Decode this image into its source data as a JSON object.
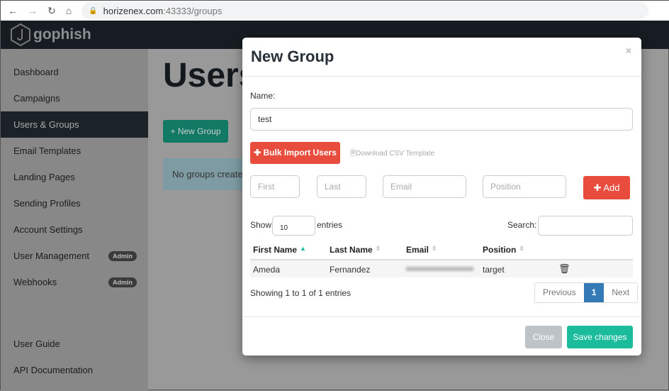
{
  "browser": {
    "url_host": "horizenex.com",
    "url_port": ":43333/groups"
  },
  "app": {
    "brand": "gophish"
  },
  "sidebar": {
    "items": [
      {
        "label": "Dashboard"
      },
      {
        "label": "Campaigns"
      },
      {
        "label": "Users & Groups",
        "active": true
      },
      {
        "label": "Email Templates"
      },
      {
        "label": "Landing Pages"
      },
      {
        "label": "Sending Profiles"
      },
      {
        "label": "Account Settings"
      },
      {
        "label": "User Management",
        "badge": "Admin"
      },
      {
        "label": "Webhooks",
        "badge": "Admin"
      }
    ],
    "bottom": [
      {
        "label": "User Guide"
      },
      {
        "label": "API Documentation"
      }
    ]
  },
  "main": {
    "title": "Users",
    "new_group": "New Group",
    "alert": "No groups created yet"
  },
  "modal": {
    "title": "New Group",
    "close": "×",
    "name_label": "Name:",
    "name_value": "test",
    "bulk_import": "Bulk Import Users",
    "download_csv": "Download CSV Template",
    "placeholders": {
      "first": "First Name",
      "last": "Last Name",
      "email": "Email",
      "position": "Position"
    },
    "add": "Add",
    "show": "Show",
    "entries_value": "10",
    "entries": "entries",
    "search": "Search:",
    "columns": [
      "First Name",
      "Last Name",
      "Email",
      "Position"
    ],
    "rows": [
      {
        "first": "Ameda",
        "last": "Fernandez",
        "position": "target"
      }
    ],
    "showing": "Showing 1 to 1 of 1 entries",
    "pager": {
      "prev": "Previous",
      "page": "1",
      "next": "Next"
    },
    "close_btn": "Close",
    "save": "Save changes"
  },
  "colors": {
    "danger": "#e74c3c",
    "primary": "#337ab7",
    "success": "#1abc9c"
  }
}
